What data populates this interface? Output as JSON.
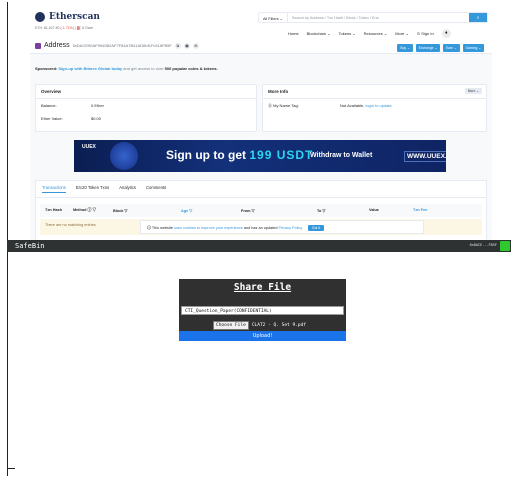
{
  "etherscan": {
    "logo_text": "Etherscan",
    "price_text": "ETH: $1,627.80",
    "price_change": "(-1.71%)",
    "gas_text": "| ⛽ 8 Gwei",
    "filter_label": "All Filters",
    "search_placeholder": "Search by Address / Txn Hash / Block / Token / Ens",
    "nav": [
      "Home",
      "Blockchain ⌄",
      "Tokens ⌄",
      "Resources ⌄",
      "More ⌄",
      "⊙ Sign In"
    ],
    "address_label": "Address",
    "address_hash": "0xDACE90AF9940B2AF7F64A7B41AD6bf1Fc516FB5F",
    "address_buttons": [
      "Buy ⌄",
      "Exchange ⌄",
      "Earn ⌄",
      "Gaming ⌄"
    ],
    "sponsored_label": "Sponsored:",
    "sponsored_link": "Sign-up with Bitmex Global today",
    "sponsored_text": "and get access to over",
    "sponsored_bold": "500 popular coins & tokens.",
    "overview": {
      "title": "Overview",
      "balance_label": "Balance:",
      "balance_value": "0 Ether",
      "value_label": "Ether Value:",
      "value_value": "$0.00"
    },
    "more_info": {
      "title": "More Info",
      "more_button": "More ⌄",
      "name_tag_label": "⓪ My Name Tag:",
      "name_tag_value": "Not Available,",
      "name_tag_link": "login to update"
    },
    "banner": {
      "logo": "UUEX",
      "main_prefix": "Sign up to get",
      "amount": "199 USDT",
      "side": "Withdraw to Wallet",
      "url": "WWW.UUEX.COM"
    },
    "tabs": [
      "Transactions",
      "Erc20 Token Txns",
      "Analytics",
      "Comments"
    ],
    "table_headers": [
      "Txn Hash",
      "Method ⓘ ▽",
      "Block ▽",
      "Age ▽",
      "From ▽",
      "To ▽",
      "Value",
      "Txn Fee"
    ],
    "empty_text": "There are no matching entries",
    "cookie": {
      "prefix": "🛈 This website",
      "link1": "uses cookies to improve your experience",
      "middle": "and has an updated",
      "link2": "Privacy Policy.",
      "button": "Got it"
    }
  },
  "safebin": {
    "title": "SafeBin",
    "user": "0x0ACE...FB5F",
    "share_title": "Share File",
    "input_value": "CTI_Question_Paper(CONFIDENTIAL)",
    "choose_label": "Choose File",
    "file_name": "CLAT2 - Q. Set 9.pdf",
    "upload_label": "Upload!"
  }
}
